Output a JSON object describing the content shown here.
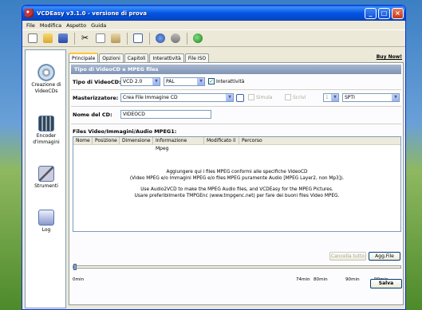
{
  "window": {
    "title": "VCDEasy v3.1.0 - versione di prova"
  },
  "menubar": {
    "items": [
      "File",
      "Modifica",
      "Aspetto",
      "Guida"
    ]
  },
  "sidebar": {
    "items": [
      {
        "label1": "Creazione di",
        "label2": "VideoCDs",
        "icon": "disc-icon"
      },
      {
        "label1": "Encoder",
        "label2": "d'immagini",
        "icon": "film-icon"
      },
      {
        "label1": "Strumenti",
        "label2": "",
        "icon": "tools-icon"
      },
      {
        "label1": "Log",
        "label2": "",
        "icon": "log-icon"
      }
    ]
  },
  "tabs": [
    "Principale",
    "Opzioni",
    "Capitoli",
    "Interattività",
    "File ISO"
  ],
  "buy_now": "Buy Now!",
  "section_title": "Tipo di VideoCD e MPEG files",
  "form": {
    "tipo_label": "Tipo di VideoCD:",
    "tipo_value": "VCD 2.0",
    "format_value": "PAL",
    "interattivita_label": "Interattività",
    "masterizzatore_label": "Masterizzatore:",
    "masterizzatore_value": "Crea File Immagine CD",
    "simula_label": "Simula",
    "scrivi_label": "Scrivi",
    "speed_value": "1",
    "driver_value": "SPTI",
    "nome_label": "Nome del CD:",
    "nome_value": "VIDEOCD"
  },
  "files": {
    "label": "Files Video/Immagini/Audio MPEG1:",
    "columns": [
      "Nome",
      "Posizione",
      "Dimensione",
      "Informazione Mpeg",
      "Modificato il",
      "Percorso"
    ],
    "msg1": "Aggiungere qui i files MPEG conformi alle specifiche VideoCD",
    "msg2": "(Video MPEG e/o Immagini MPEG e/o files MPEG puramente Audio [MPEG Layer2, non Mp3]).",
    "msg3": "Use Audio2VCD to make the MPEG Audio files, and VCDEasy for the MPEG Pictures.",
    "msg4": "Usare preferibilmente TMPGEnc (www.tmpgenc.net) per fare dei buoni files Video MPEG."
  },
  "buttons": {
    "cancella": "Cancella tutto",
    "aggiungi": "Agg.File",
    "salva": "Salva"
  },
  "ruler": {
    "ticks": [
      "0min",
      "74min",
      "80min",
      "90min",
      "99min"
    ]
  }
}
